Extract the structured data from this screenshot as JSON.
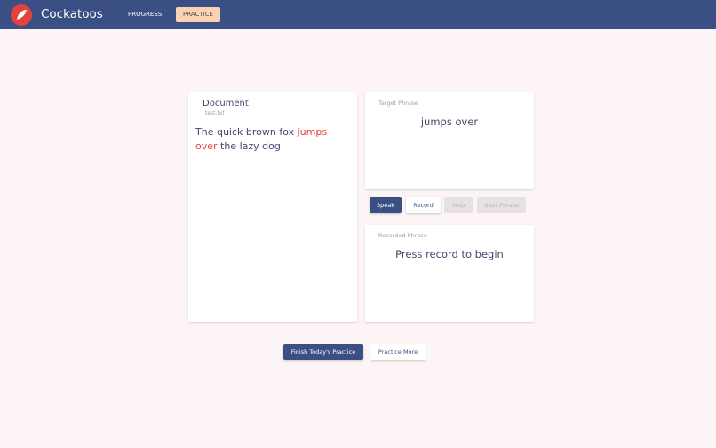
{
  "header": {
    "app_title": "Cockatoos",
    "nav": {
      "progress": "PROGRESS",
      "practice": "PRACTICE"
    },
    "logo_icon": "cockatoo-logo-icon",
    "colors": {
      "bar": "#3a5085",
      "logo": "#e2443b",
      "active_tab": "#fbd3b2"
    }
  },
  "document": {
    "title": "Document",
    "filename": "_test.txt",
    "text_before": "The quick brown fox ",
    "text_highlight": "jumps over",
    "text_after": " the lazy dog.",
    "highlight_color": "#e2443b"
  },
  "target": {
    "label": "Target Phrase",
    "phrase": "jumps over"
  },
  "controls": {
    "speak": "Speak",
    "record": "Record",
    "stop": "Stop",
    "next": "Next Phrase"
  },
  "recorded": {
    "label": "Recorded Phrase",
    "message": "Press record to begin"
  },
  "footer": {
    "finish": "Finish Today's Practice",
    "more": "Practice More"
  }
}
